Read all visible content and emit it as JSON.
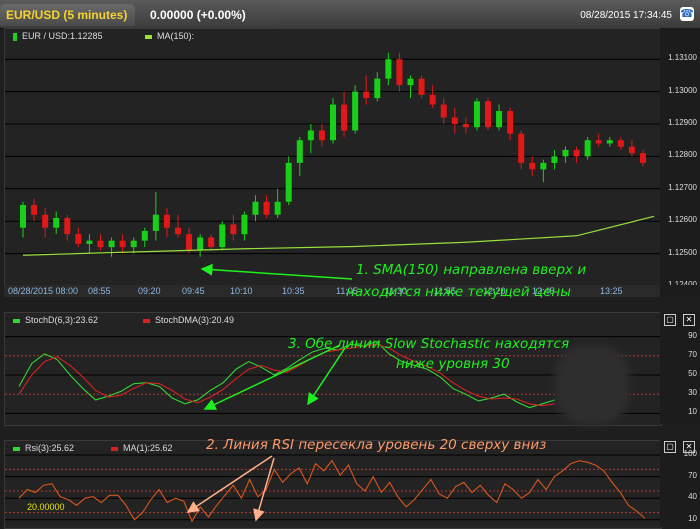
{
  "header": {
    "symbol_tab": "EUR/USD (5 minutes)",
    "price_tab": "0.00000 (+0.00%)",
    "datetime": "08/28/2015 17:34:45"
  },
  "main_pane": {
    "legend_price": "EUR / USD:1.12285",
    "legend_ma": "MA(150):",
    "y_ticks": [
      "1.13100",
      "1.13000",
      "1.12900",
      "1.12800",
      "1.12700",
      "1.12600",
      "1.12500",
      "1.12400"
    ],
    "x_labels": [
      "08/28/2015 08:00",
      "08:55",
      "09:20",
      "09:45",
      "10:10",
      "10:35",
      "11:05",
      "11:30",
      "11:55",
      "12:20",
      "12:45",
      "13:25"
    ]
  },
  "stoch_pane": {
    "legend_d": "StochD(6,3):23.62",
    "legend_dma": "StochDMA(3):20.49",
    "y_ticks": [
      "90",
      "70",
      "50",
      "30",
      "10"
    ]
  },
  "rsi_pane": {
    "legend_rsi": "Rsi(3):25.62",
    "legend_ma": "MA(1):25.62",
    "level_label": "20.00000",
    "y_ticks": [
      "100",
      "70",
      "40",
      "10"
    ]
  },
  "annotations": {
    "sma_line1": "1. SMA(150) направлена вверх и",
    "sma_line2": "находится ниже текущей цены",
    "stoch_line1": "3. Обе линии Slow Stochastic находятся",
    "stoch_line2": "ниже уровня 30",
    "rsi_line": "2. Линия RSI пересекла уровень 20 сверху вниз"
  },
  "icons": {
    "phone": "phone-icon",
    "restore": "restore-icon",
    "close": "close-icon"
  },
  "colors": {
    "bull": "#19d019",
    "bear": "#e01818",
    "ma": "#9ae03c",
    "annotation": "#1ef01e",
    "stoch_d": "#34d534",
    "stoch_dma": "#d62222",
    "rsi": "#d9571c"
  },
  "chart_data": [
    {
      "type": "candlestick",
      "title": "EUR / USD",
      "ylim": [
        1.124,
        1.1315
      ],
      "x_range": [
        "08:00",
        "13:30"
      ],
      "series": [
        {
          "name": "EUR / USD",
          "ohlc": [
            [
              1.1258,
              1.1266,
              1.1255,
              1.1265
            ],
            [
              1.1265,
              1.1267,
              1.126,
              1.1262
            ],
            [
              1.1262,
              1.1264,
              1.1255,
              1.1258
            ],
            [
              1.1258,
              1.1263,
              1.1256,
              1.1261
            ],
            [
              1.1261,
              1.1262,
              1.1254,
              1.1256
            ],
            [
              1.1256,
              1.1258,
              1.1252,
              1.1253
            ],
            [
              1.1253,
              1.1256,
              1.125,
              1.1254
            ],
            [
              1.1254,
              1.1256,
              1.1251,
              1.1252
            ],
            [
              1.1252,
              1.1255,
              1.1249,
              1.1254
            ],
            [
              1.1254,
              1.1256,
              1.125,
              1.1252
            ],
            [
              1.1252,
              1.1255,
              1.125,
              1.1254
            ],
            [
              1.1254,
              1.1258,
              1.1252,
              1.1257
            ],
            [
              1.1257,
              1.1269,
              1.1254,
              1.1262
            ],
            [
              1.1262,
              1.1264,
              1.1255,
              1.1258
            ],
            [
              1.1258,
              1.1262,
              1.1255,
              1.1256
            ],
            [
              1.1256,
              1.1258,
              1.125,
              1.1251
            ],
            [
              1.1251,
              1.1256,
              1.1249,
              1.1255
            ],
            [
              1.1255,
              1.1256,
              1.1251,
              1.1252
            ],
            [
              1.1252,
              1.126,
              1.1251,
              1.1259
            ],
            [
              1.1259,
              1.1262,
              1.1254,
              1.1256
            ],
            [
              1.1256,
              1.1263,
              1.1254,
              1.1262
            ],
            [
              1.1262,
              1.1268,
              1.126,
              1.1266
            ],
            [
              1.1266,
              1.1268,
              1.1261,
              1.1262
            ],
            [
              1.1262,
              1.127,
              1.1261,
              1.1266
            ],
            [
              1.1266,
              1.128,
              1.1265,
              1.1278
            ],
            [
              1.1278,
              1.1286,
              1.1274,
              1.1285
            ],
            [
              1.1285,
              1.129,
              1.1281,
              1.1288
            ],
            [
              1.1288,
              1.129,
              1.1283,
              1.1285
            ],
            [
              1.1285,
              1.1298,
              1.1284,
              1.1296
            ],
            [
              1.1296,
              1.13,
              1.1286,
              1.1288
            ],
            [
              1.1288,
              1.1302,
              1.1287,
              1.13
            ],
            [
              1.13,
              1.1305,
              1.1296,
              1.1298
            ],
            [
              1.1298,
              1.1306,
              1.1297,
              1.1304
            ],
            [
              1.1304,
              1.1312,
              1.1302,
              1.131
            ],
            [
              1.131,
              1.1312,
              1.13,
              1.1302
            ],
            [
              1.1302,
              1.1305,
              1.1298,
              1.1304
            ],
            [
              1.1304,
              1.1305,
              1.1298,
              1.1299
            ],
            [
              1.1299,
              1.1302,
              1.1295,
              1.1296
            ],
            [
              1.1296,
              1.1298,
              1.129,
              1.1292
            ],
            [
              1.1292,
              1.1295,
              1.1287,
              1.129
            ],
            [
              1.129,
              1.1292,
              1.1287,
              1.1289
            ],
            [
              1.1289,
              1.1298,
              1.1288,
              1.1297
            ],
            [
              1.1297,
              1.1298,
              1.1288,
              1.1289
            ],
            [
              1.1289,
              1.1296,
              1.1288,
              1.1294
            ],
            [
              1.1294,
              1.1295,
              1.1285,
              1.1287
            ],
            [
              1.1287,
              1.1288,
              1.1276,
              1.1278
            ],
            [
              1.1278,
              1.128,
              1.1274,
              1.1276
            ],
            [
              1.1276,
              1.1279,
              1.1272,
              1.1278
            ],
            [
              1.1278,
              1.1282,
              1.1276,
              1.128
            ],
            [
              1.128,
              1.1283,
              1.1278,
              1.1282
            ],
            [
              1.1282,
              1.1283,
              1.1278,
              1.128
            ],
            [
              1.128,
              1.1286,
              1.1279,
              1.1285
            ],
            [
              1.1285,
              1.1287,
              1.1283,
              1.1284
            ],
            [
              1.1284,
              1.1286,
              1.1283,
              1.1285
            ],
            [
              1.1285,
              1.1286,
              1.1282,
              1.1283
            ],
            [
              1.1283,
              1.1285,
              1.128,
              1.1281
            ],
            [
              1.1281,
              1.1282,
              1.1277,
              1.1278
            ]
          ]
        },
        {
          "name": "MA(150)",
          "values": [
            [
              0,
              1.12495
            ],
            [
              10,
              1.12505
            ],
            [
              20,
              1.12515
            ],
            [
              30,
              1.12522
            ],
            [
              40,
              1.12535
            ],
            [
              50,
              1.12555
            ],
            [
              57,
              1.12615
            ]
          ]
        }
      ]
    },
    {
      "type": "line",
      "title": "StochD(6,3)",
      "ylim": [
        0,
        100
      ],
      "y_ticks": [
        10,
        30,
        50,
        70,
        90
      ],
      "series": [
        {
          "name": "StochD(6,3)",
          "values": [
            38,
            62,
            72,
            66,
            50,
            36,
            24,
            28,
            33,
            41,
            42,
            38,
            26,
            20,
            24,
            34,
            42,
            56,
            64,
            58,
            50,
            57,
            66,
            74,
            78,
            76,
            82,
            80,
            85,
            72,
            64,
            60,
            56,
            48,
            36,
            30,
            23,
            26,
            30,
            22,
            16,
            20,
            24
          ]
        },
        {
          "name": "StochDMA(3)",
          "values": [
            30,
            50,
            64,
            69,
            60,
            48,
            34,
            27,
            29,
            36,
            42,
            41,
            34,
            25,
            21,
            27,
            35,
            46,
            56,
            60,
            55,
            53,
            60,
            68,
            74,
            76,
            78,
            80,
            82,
            78,
            70,
            64,
            59,
            52,
            42,
            34,
            28,
            25,
            26,
            25,
            20,
            18,
            20
          ]
        }
      ]
    },
    {
      "type": "line",
      "title": "Rsi(3)",
      "ylim": [
        0,
        100
      ],
      "y_ticks": [
        10,
        40,
        70,
        100
      ],
      "series": [
        {
          "name": "Rsi(3)",
          "values": [
            40,
            52,
            48,
            58,
            60,
            42,
            38,
            30,
            40,
            42,
            34,
            44,
            44,
            30,
            10,
            20,
            38,
            52,
            34,
            40,
            36,
            8,
            28,
            14,
            30,
            44,
            58,
            40,
            66,
            42,
            52,
            80,
            62,
            74,
            82,
            60,
            88,
            78,
            92,
            72,
            86,
            60,
            50,
            70,
            48,
            62,
            42,
            28,
            38,
            52,
            66,
            46,
            40,
            56,
            62,
            48,
            58,
            44,
            34,
            60,
            52,
            40,
            48,
            66,
            52,
            70,
            78,
            88,
            92,
            90,
            86,
            78,
            62,
            48,
            30,
            22,
            12
          ]
        },
        {
          "name": "MA(1)",
          "values": [
            40,
            52,
            48,
            58,
            60,
            42,
            38,
            30,
            40,
            42,
            34,
            44,
            44,
            30,
            10,
            20,
            38,
            52,
            34,
            40,
            36,
            8,
            28,
            14,
            30,
            44,
            58,
            40,
            66,
            42,
            52,
            80,
            62,
            74,
            82,
            60,
            88,
            78,
            92,
            72,
            86,
            60,
            50,
            70,
            48,
            62,
            42,
            28,
            38,
            52,
            66,
            46,
            40,
            56,
            62,
            48,
            58,
            44,
            34,
            60,
            52,
            40,
            48,
            66,
            52,
            70,
            78,
            88,
            92,
            90,
            86,
            78,
            62,
            48,
            30,
            22,
            12
          ]
        }
      ]
    }
  ]
}
